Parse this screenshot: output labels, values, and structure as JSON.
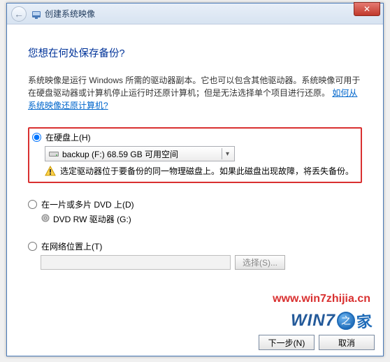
{
  "titlebar": {
    "title": "创建系统映像",
    "close": "✕"
  },
  "heading": "您想在何处保存备份?",
  "description": "系统映像是运行 Windows 所需的驱动器副本。它也可以包含其他驱动器。系统映像可用于在硬盘驱动器或计算机停止运行时还原计算机；但是无法选择单个项目进行还原。",
  "link": "如何从系统映像还原计算机?",
  "options": {
    "hdd": {
      "label": "在硬盘上(H)",
      "drive_text": "backup (F:)  68.59 GB 可用空间",
      "warning": "选定驱动器位于要备份的同一物理磁盘上。如果此磁盘出现故障，将丢失备份。"
    },
    "dvd": {
      "label": "在一片或多片 DVD 上(D)",
      "drive_text": "DVD RW 驱动器 (G:)"
    },
    "network": {
      "label": "在网络位置上(T)",
      "browse": "选择(S)..."
    }
  },
  "footer": {
    "next": "下一步(N)",
    "cancel": "取消"
  },
  "watermark": "www.win7zhijia.cn",
  "logo": {
    "text": "WIN7",
    "zhi": "之",
    "jia": "家"
  }
}
